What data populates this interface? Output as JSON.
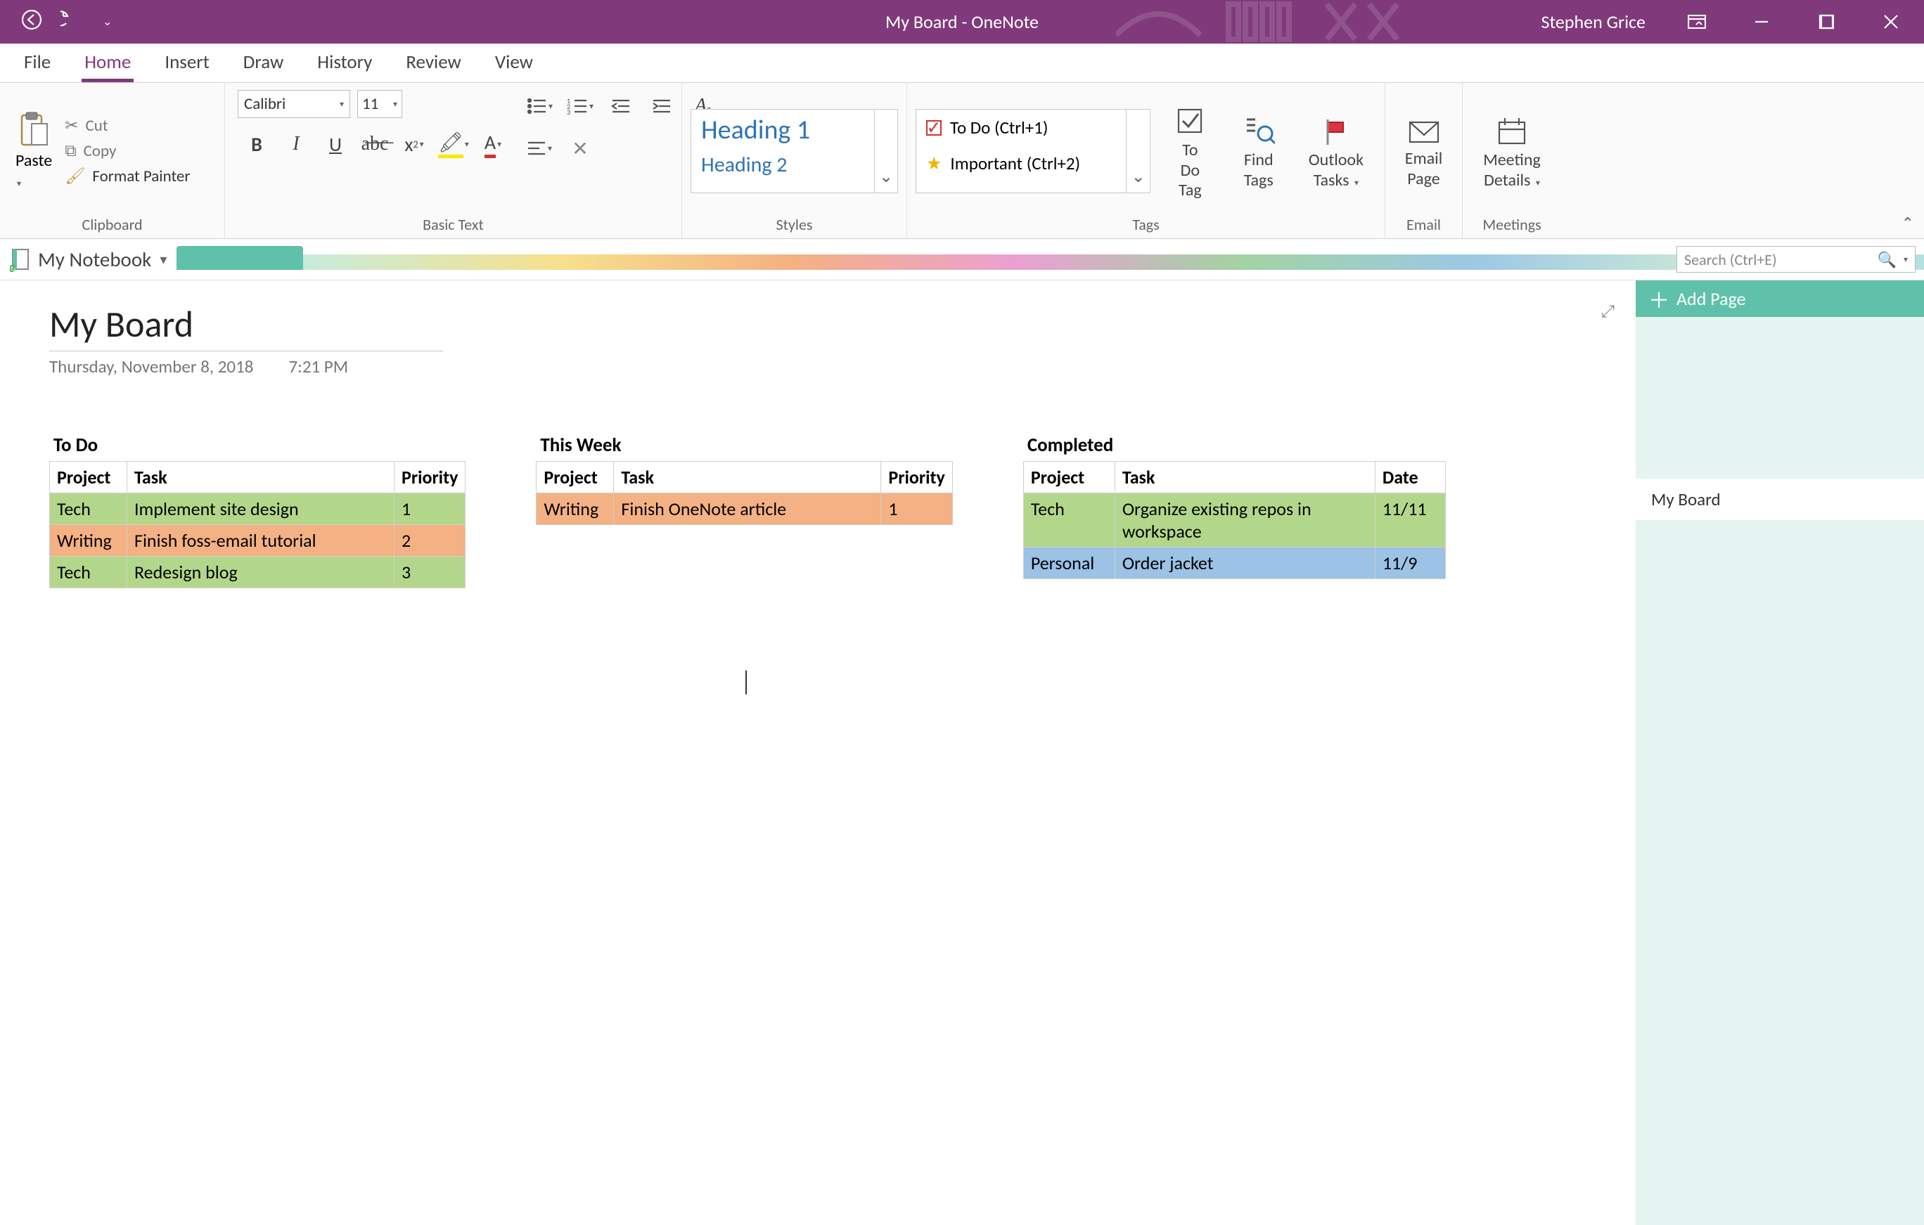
{
  "titlebar": {
    "title": "My Board  -  OneNote",
    "user": "Stephen Grice"
  },
  "tabs": [
    "File",
    "Home",
    "Insert",
    "Draw",
    "History",
    "Review",
    "View"
  ],
  "active_tab": "Home",
  "ribbon": {
    "clipboard": {
      "paste": "Paste",
      "cut": "Cut",
      "copy": "Copy",
      "format_painter": "Format Painter",
      "label": "Clipboard"
    },
    "basic_text": {
      "font": "Calibri",
      "size": "11",
      "label": "Basic Text"
    },
    "styles": {
      "h1": "Heading 1",
      "h2": "Heading 2",
      "label": "Styles"
    },
    "tags": {
      "todo": "To Do (Ctrl+1)",
      "important": "Important (Ctrl+2)",
      "todo_tag": "To Do Tag",
      "find_tags": "Find Tags",
      "outlook_tasks": "Outlook Tasks",
      "label": "Tags"
    },
    "email": {
      "btn": "Email Page",
      "label": "Email"
    },
    "meetings": {
      "btn": "Meeting Details",
      "label": "Meetings"
    }
  },
  "notebook": {
    "name": "My Notebook"
  },
  "search": {
    "placeholder": "Search (Ctrl+E)"
  },
  "add_page": "Add Page",
  "page_list": [
    "My Board"
  ],
  "page": {
    "title": "My Board",
    "date": "Thursday, November 8, 2018",
    "time": "7:21 PM"
  },
  "boards": {
    "todo": {
      "title": "To Do",
      "headers": [
        "Project",
        "Task",
        "Priority"
      ],
      "rows": [
        {
          "cls": "green",
          "cells": [
            "Tech",
            "Implement site design",
            "1"
          ]
        },
        {
          "cls": "orange",
          "cells": [
            "Writing",
            "Finish foss-email tutorial",
            "2"
          ]
        },
        {
          "cls": "green",
          "cells": [
            "Tech",
            "Redesign blog",
            "3"
          ]
        }
      ]
    },
    "thisweek": {
      "title": "This Week",
      "headers": [
        "Project",
        "Task",
        "Priority"
      ],
      "rows": [
        {
          "cls": "orange",
          "cells": [
            "Writing",
            "Finish OneNote article",
            "1"
          ]
        }
      ]
    },
    "completed": {
      "title": "Completed",
      "headers": [
        "Project",
        "Task",
        "Date"
      ],
      "rows": [
        {
          "cls": "green",
          "cells": [
            "Tech",
            "Organize existing repos in workspace",
            "11/11"
          ]
        },
        {
          "cls": "blue",
          "cells": [
            "Personal",
            "Order jacket",
            "11/9"
          ]
        }
      ]
    }
  },
  "col_widths": {
    "todo": [
      110,
      380,
      100
    ],
    "thisweek": [
      110,
      380,
      100
    ],
    "completed": [
      130,
      370,
      100
    ]
  }
}
